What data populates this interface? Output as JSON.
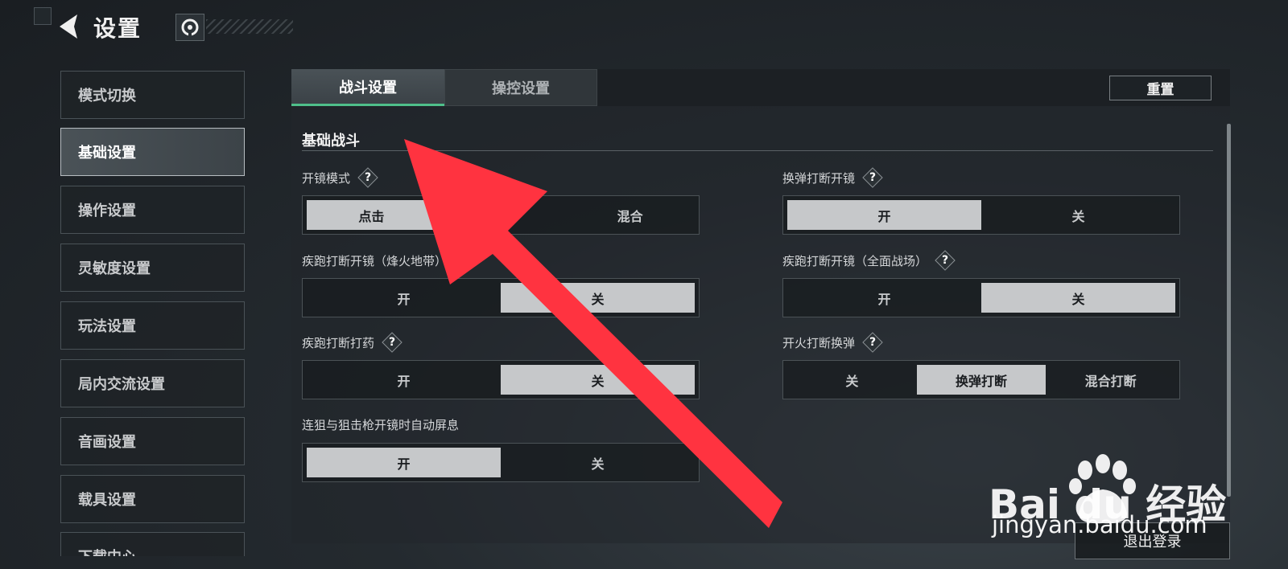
{
  "header": {
    "title": "设置"
  },
  "sidebar": {
    "items": [
      {
        "label": "模式切换"
      },
      {
        "label": "基础设置"
      },
      {
        "label": "操作设置"
      },
      {
        "label": "灵敏度设置"
      },
      {
        "label": "玩法设置"
      },
      {
        "label": "局内交流设置"
      },
      {
        "label": "音画设置"
      },
      {
        "label": "载具设置"
      },
      {
        "label": "下载中心"
      }
    ],
    "active_index": 1
  },
  "tabs": [
    {
      "label": "战斗设置"
    },
    {
      "label": "操控设置"
    }
  ],
  "active_tab": 0,
  "reset_label": "重置",
  "section": {
    "title": "基础战斗"
  },
  "help_mark": "?",
  "settings": {
    "scope_mode": {
      "label": "开镜模式",
      "options": [
        "点击",
        "",
        "混合"
      ],
      "selected": "点击"
    },
    "reload_interrupt_scope": {
      "label": "换弹打断开镜",
      "options": [
        "开",
        "关"
      ],
      "selected": "开"
    },
    "sprint_interrupt_scope_warzone": {
      "label": "疾跑打断开镜（烽火地带）",
      "options": [
        "开",
        "关"
      ],
      "selected": "关"
    },
    "sprint_interrupt_scope_fullscale": {
      "label": "疾跑打断开镜（全面战场）",
      "options": [
        "开",
        "关"
      ],
      "selected": "关"
    },
    "sprint_interrupt_meds": {
      "label": "疾跑打断打药",
      "options": [
        "开",
        "关"
      ],
      "selected": "关"
    },
    "fire_interrupt_reload": {
      "label": "开火打断换弹",
      "options": [
        "关",
        "换弹打断",
        "混合打断"
      ],
      "selected": "换弹打断"
    },
    "sniper_auto_hold_breath": {
      "label": "连狙与狙击枪开镜时自动屏息",
      "options": [
        "开",
        "关"
      ],
      "selected": "开"
    }
  },
  "logout_label": "退出登录",
  "watermark": {
    "brand": "Bai du 经验",
    "url": "jingyan.baidu.com"
  },
  "colors": {
    "accent_tab": "#4fbf8a",
    "arrow": "#ff3340",
    "selected_option_bg": "#c6c8ca"
  }
}
